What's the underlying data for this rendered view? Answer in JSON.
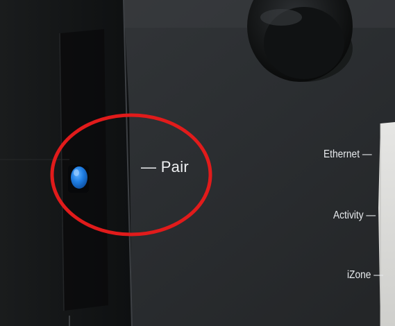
{
  "photo": {
    "subject": "close-up photo of a dark control unit with a blue pair button",
    "labels": {
      "pair": "— Pair",
      "ethernet": "Ethernet —",
      "activity": "Activity —",
      "izone": "iZone —"
    },
    "colors": {
      "device_body": "#2b2e31",
      "side_panel": "#0f1112",
      "pair_button": "#1f7ee3",
      "highlight_circle": "#e11b1b",
      "label_text": "#e9ecef",
      "background_wall": "#d8d8d6"
    },
    "annotation": {
      "type": "red circle highlighting the pair button"
    }
  }
}
